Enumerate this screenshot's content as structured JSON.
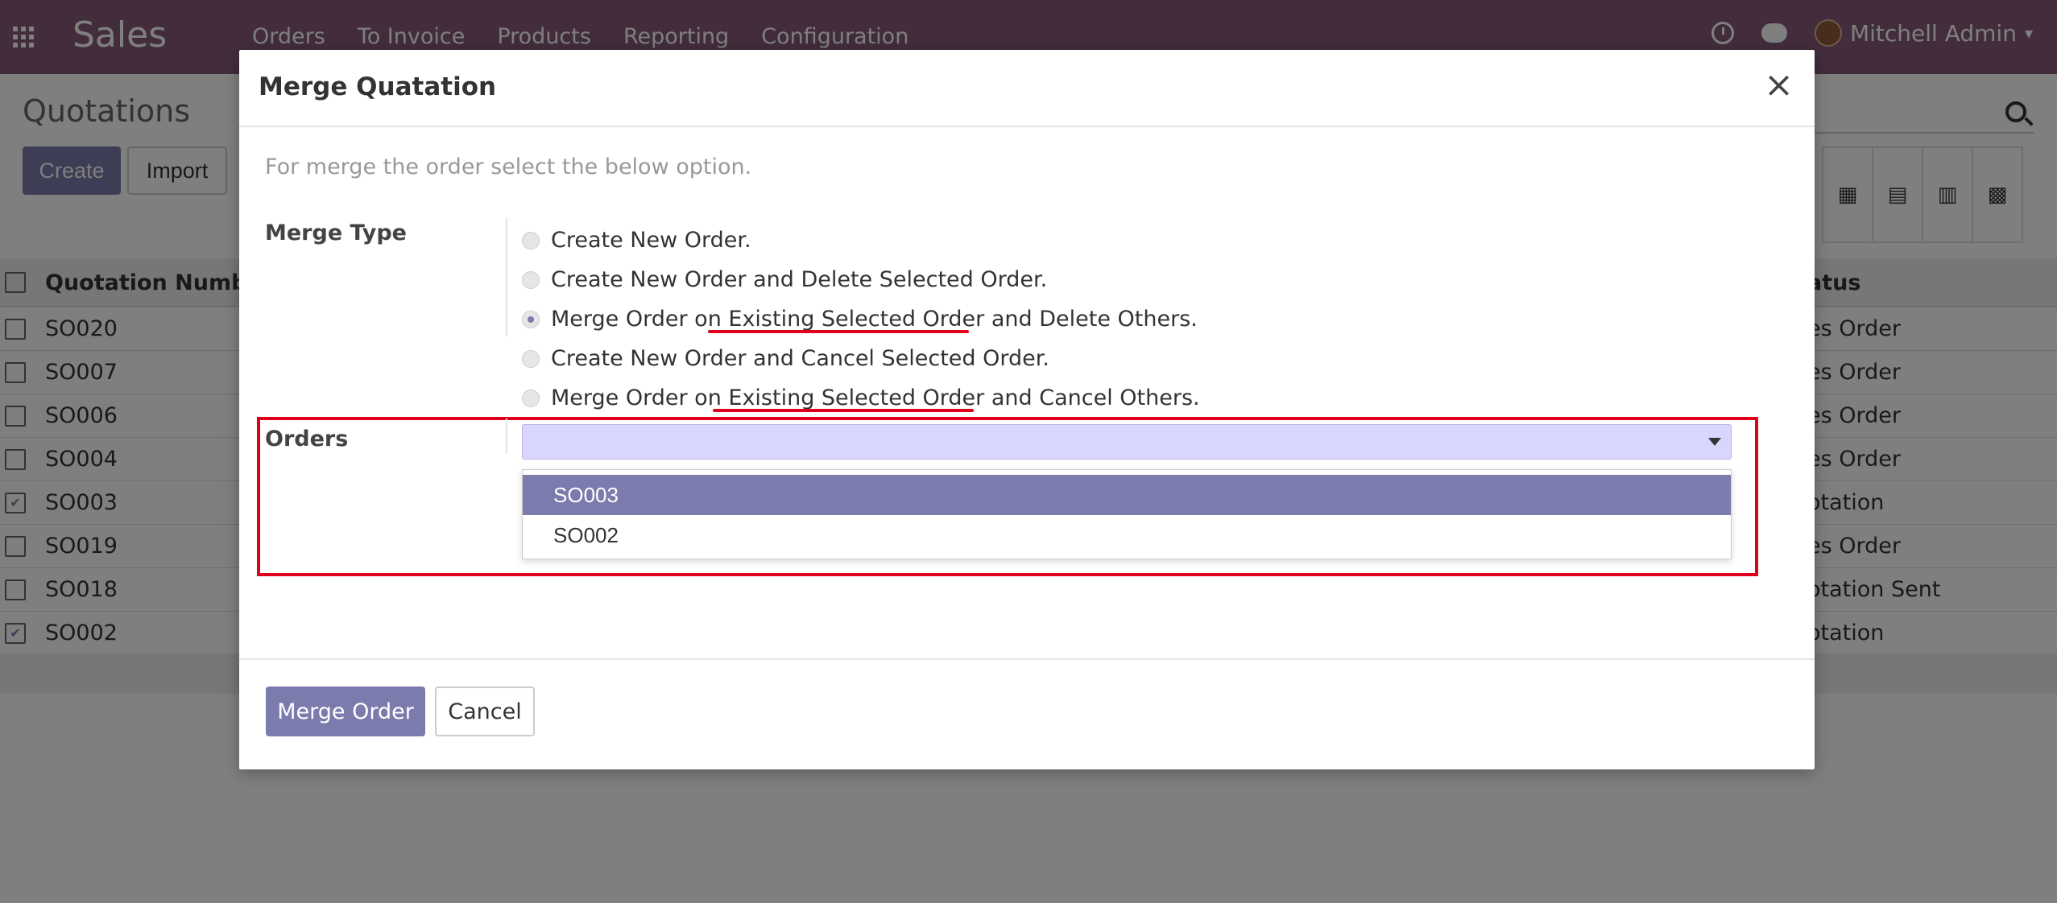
{
  "navbar": {
    "app_name": "Sales",
    "menu": [
      "Orders",
      "To Invoice",
      "Products",
      "Reporting",
      "Configuration"
    ],
    "user": "Mitchell Admin"
  },
  "control": {
    "title": "Quotations",
    "create_label": "Create",
    "import_label": "Import"
  },
  "list": {
    "col_number": "Quotation Numbe",
    "col_status": "atus",
    "rows": [
      {
        "number": "SO020",
        "status": "es Order",
        "checked": false
      },
      {
        "number": "SO007",
        "status": "es Order",
        "checked": false
      },
      {
        "number": "SO006",
        "status": "es Order",
        "checked": false
      },
      {
        "number": "SO004",
        "status": "es Order",
        "checked": false
      },
      {
        "number": "SO003",
        "status": "otation",
        "checked": true
      },
      {
        "number": "SO019",
        "status": "es Order",
        "checked": false
      },
      {
        "number": "SO018",
        "status": "otation Sent",
        "checked": false
      },
      {
        "number": "SO002",
        "status": "otation",
        "checked": true
      }
    ]
  },
  "modal": {
    "title": "Merge Quatation",
    "hint": "For merge the order select the below option.",
    "merge_type_label": "Merge Type",
    "options": [
      {
        "label": "Create New Order.",
        "selected": false
      },
      {
        "label": "Create New Order and Delete Selected Order.",
        "selected": false
      },
      {
        "label": "Merge Order on Existing Selected Order and Delete Others.",
        "selected": true
      },
      {
        "label": "Create New Order and Cancel Selected Order.",
        "selected": false
      },
      {
        "label": "Merge Order on Existing Selected Order and Cancel Others.",
        "selected": false
      }
    ],
    "orders_label": "Orders",
    "orders_value": "",
    "dropdown": [
      "SO003",
      "SO002"
    ],
    "merge_button": "Merge Order",
    "cancel_button": "Cancel"
  },
  "colors": {
    "brand": "#875a7b",
    "primary": "#7c7bad",
    "highlight": "#e0001b"
  }
}
